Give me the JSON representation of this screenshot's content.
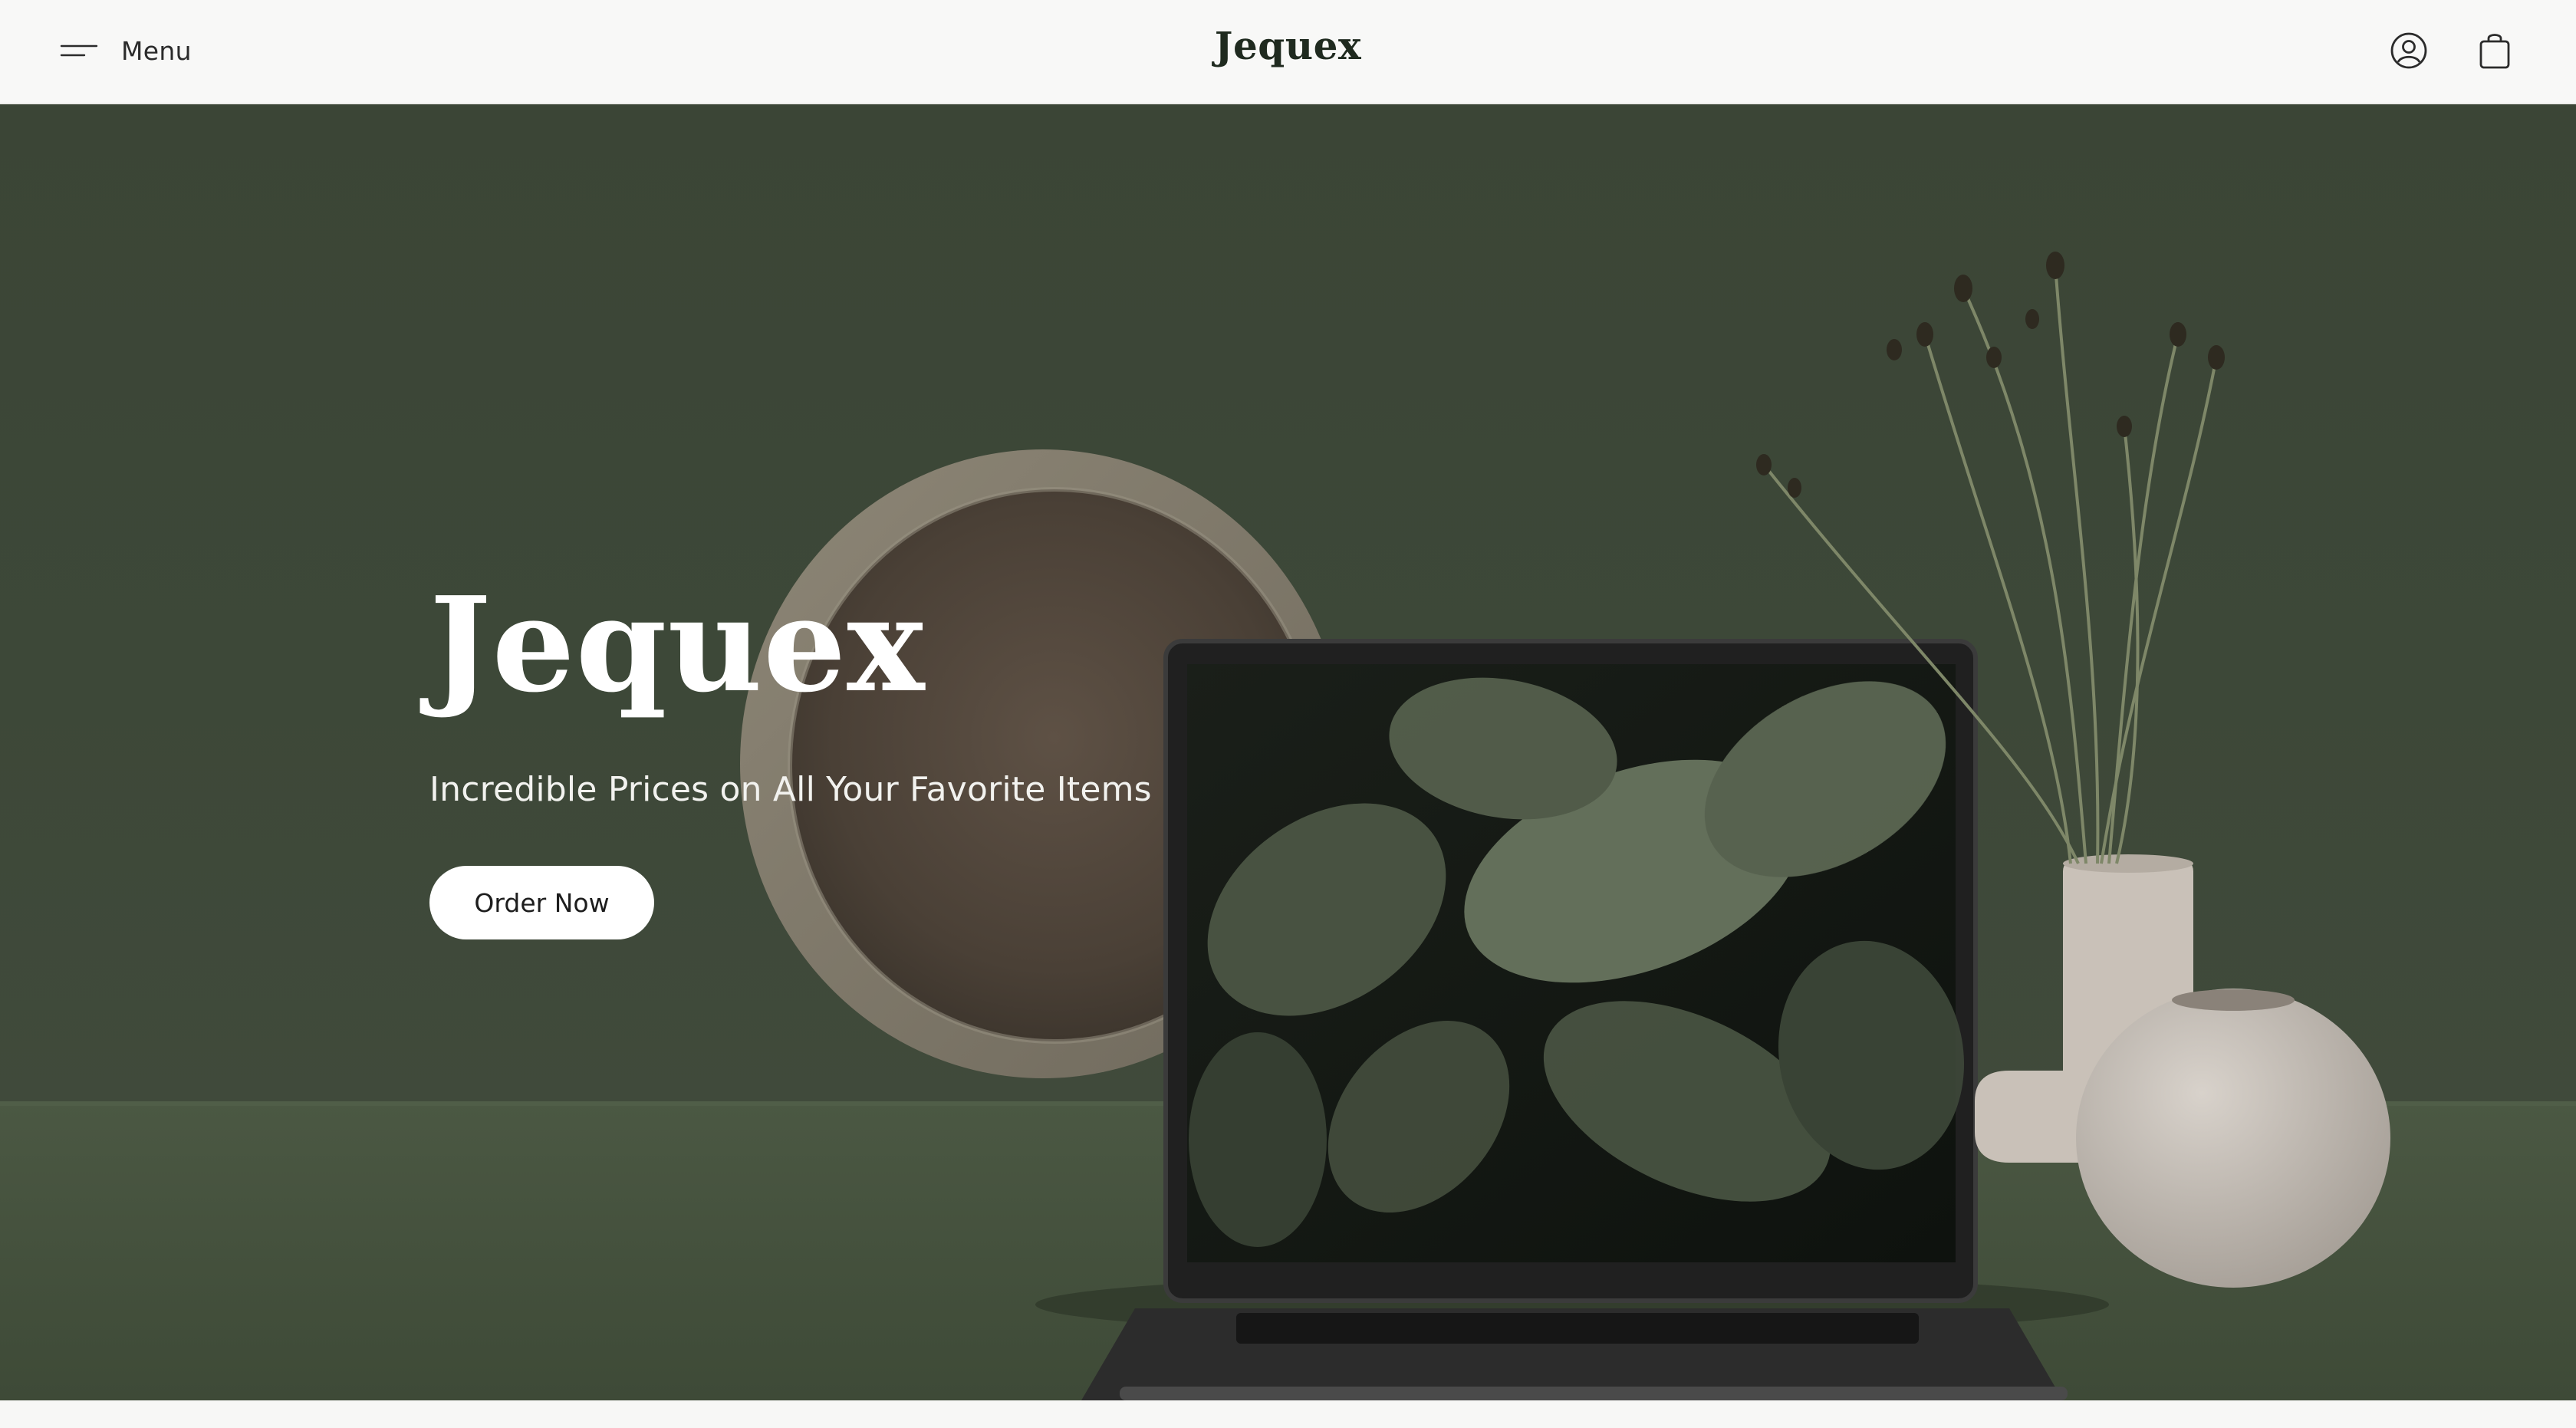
{
  "header": {
    "menu_label": "Menu",
    "logo": "Jequex",
    "icons": [
      "menu-icon",
      "account-icon",
      "shopping-bag-icon"
    ]
  },
  "hero": {
    "title": "Jequex",
    "subtitle": "Incredible Prices on All Your Favorite Items",
    "cta_label": "Order Now"
  },
  "colors": {
    "header_bg": "#f8f8f7",
    "hero_bg": "#3d4838",
    "button_bg": "#ffffff",
    "text_dark": "#1f2a1f",
    "text_light": "#ffffff"
  }
}
